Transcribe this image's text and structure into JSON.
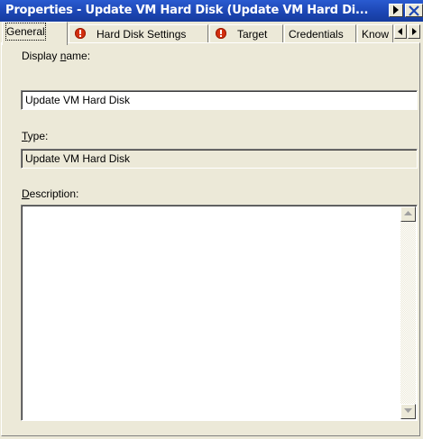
{
  "window": {
    "title": "Properties - Update VM Hard Disk (Update VM Hard Di...",
    "controls": [
      "help-icon",
      "close-icon"
    ]
  },
  "tabs": [
    {
      "label": "General",
      "active": true,
      "has_error": false
    },
    {
      "label": "Hard Disk Settings",
      "active": false,
      "has_error": true
    },
    {
      "label": "Target",
      "active": false,
      "has_error": true
    },
    {
      "label": "Credentials",
      "active": false,
      "has_error": false
    },
    {
      "label": "Know",
      "active": false,
      "has_error": false
    }
  ],
  "form": {
    "display_name": {
      "label_pre": "Display ",
      "label_key": "n",
      "label_post": "ame:",
      "value": "Update VM Hard Disk"
    },
    "type": {
      "label_key": "T",
      "label_post": "ype:",
      "value": "Update VM Hard Disk"
    },
    "description": {
      "label_key": "D",
      "label_post": "escription:",
      "value": ""
    }
  },
  "colors": {
    "titlebar": "#1c46b4",
    "error_icon": "#d32e0e",
    "face": "#ece9d8"
  }
}
